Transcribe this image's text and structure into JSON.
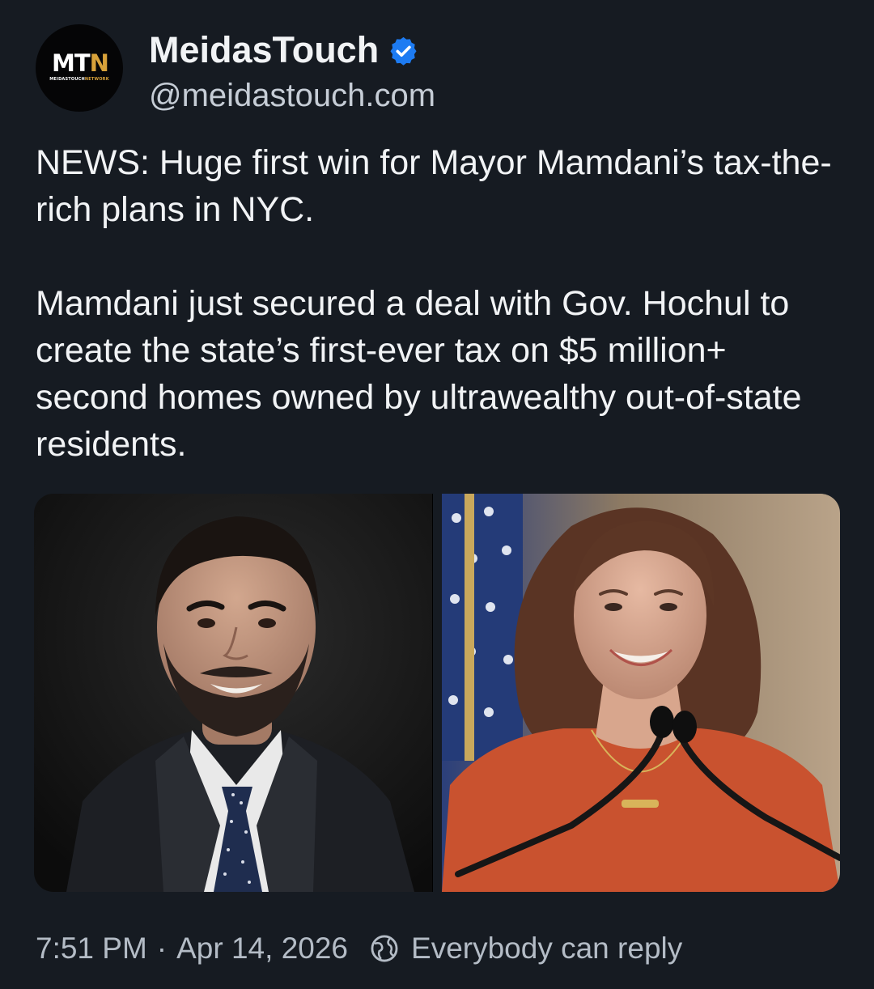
{
  "author": {
    "display_name": "MeidasTouch",
    "handle": "@meidastouch.com",
    "avatar": {
      "logo_text_white": "MT",
      "logo_text_gold": "N",
      "logo_sub_white": "MEIDASTOUCH",
      "logo_sub_gold": "NETWORK"
    },
    "verified_icon": "verified-checkmark-icon"
  },
  "post": {
    "paragraphs": [
      "NEWS: Huge first win for Mayor Mamdani’s tax-the-rich plans in NYC.",
      "Mamdani just secured a deal with Gov. Hochul to create the state’s first-ever tax on $5 million+ second homes owned by ultrawealthy out-of-state residents."
    ],
    "images": [
      {
        "subject": "photo-man-suit"
      },
      {
        "subject": "photo-woman-podium"
      }
    ]
  },
  "meta": {
    "time": "7:51 PM",
    "separator": "·",
    "date": "Apr 14, 2026",
    "reply_icon": "globe-icon",
    "reply_setting": "Everybody can reply"
  },
  "colors": {
    "background": "#161b22",
    "text": "#f1f3f5",
    "secondary_text": "#b4bcc6",
    "verified": "#1d7bf2",
    "logo_gold": "#d8a23a"
  }
}
